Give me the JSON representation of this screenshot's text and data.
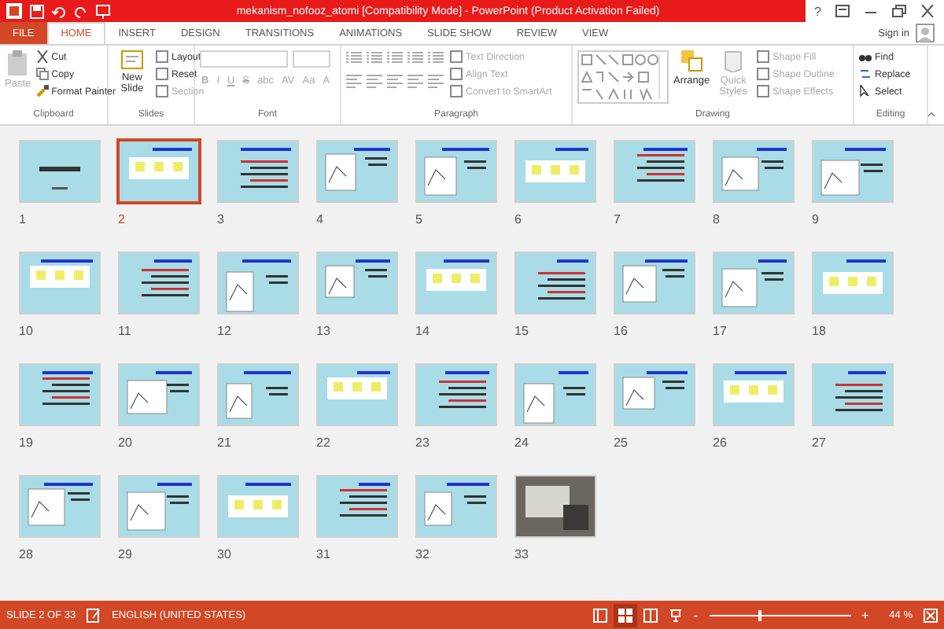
{
  "window": {
    "title": "mekanism_nofooz_atomi [Compatibility Mode] - PowerPoint (Product Activation Failed)",
    "help": "?"
  },
  "tabs": [
    {
      "label": "FILE",
      "kind": "file",
      "selected": false
    },
    {
      "label": "HOME",
      "kind": "tab",
      "selected": true
    },
    {
      "label": "INSERT",
      "kind": "tab",
      "selected": false
    },
    {
      "label": "DESIGN",
      "kind": "tab",
      "selected": false
    },
    {
      "label": "TRANSITIONS",
      "kind": "tab",
      "selected": false
    },
    {
      "label": "ANIMATIONS",
      "kind": "tab",
      "selected": false
    },
    {
      "label": "SLIDE SHOW",
      "kind": "tab",
      "selected": false
    },
    {
      "label": "REVIEW",
      "kind": "tab",
      "selected": false
    },
    {
      "label": "VIEW",
      "kind": "tab",
      "selected": false
    }
  ],
  "account": {
    "label": "Sign in"
  },
  "ribbon": {
    "clipboard": {
      "title": "Clipboard",
      "paste": {
        "label": "Paste",
        "disabled": true
      },
      "commands": [
        {
          "label": "Cut",
          "disabled": false
        },
        {
          "label": "Copy",
          "disabled": false
        },
        {
          "label": "Format Painter",
          "disabled": false
        }
      ]
    },
    "slides": {
      "title": "Slides",
      "new_slide": "New Slide",
      "commands": [
        {
          "label": "Layout",
          "disabled": false
        },
        {
          "label": "Reset",
          "disabled": false
        },
        {
          "label": "Section",
          "disabled": true
        }
      ]
    },
    "font": {
      "title": "Font",
      "disabled": true,
      "buttons": [
        "B",
        "I",
        "U",
        "S",
        "abc",
        "AV",
        "Aa",
        "A"
      ]
    },
    "paragraph": {
      "title": "Paragraph",
      "commands": [
        {
          "label": "Text Direction",
          "disabled": true
        },
        {
          "label": "Align Text",
          "disabled": true
        },
        {
          "label": "Convert to SmartArt",
          "disabled": true
        }
      ]
    },
    "drawing": {
      "title": "Drawing",
      "arrange": "Arrange",
      "quick_styles": "Quick Styles",
      "commands": [
        {
          "label": "Shape Fill",
          "disabled": true
        },
        {
          "label": "Shape Outline",
          "disabled": true
        },
        {
          "label": "Shape Effects",
          "disabled": true
        }
      ]
    },
    "editing": {
      "title": "Editing",
      "commands": [
        {
          "label": "Find",
          "disabled": false
        },
        {
          "label": "Replace",
          "disabled": false
        },
        {
          "label": "Select",
          "disabled": false
        }
      ]
    }
  },
  "slides": [
    {
      "number": "1",
      "kind": "title",
      "selected": false
    },
    {
      "number": "2",
      "kind": "content",
      "selected": true
    },
    {
      "number": "3",
      "kind": "content",
      "selected": false
    },
    {
      "number": "4",
      "kind": "content",
      "selected": false
    },
    {
      "number": "5",
      "kind": "content",
      "selected": false
    },
    {
      "number": "6",
      "kind": "content",
      "selected": false
    },
    {
      "number": "7",
      "kind": "content",
      "selected": false
    },
    {
      "number": "8",
      "kind": "content",
      "selected": false
    },
    {
      "number": "9",
      "kind": "content",
      "selected": false
    },
    {
      "number": "10",
      "kind": "content",
      "selected": false
    },
    {
      "number": "11",
      "kind": "content",
      "selected": false
    },
    {
      "number": "12",
      "kind": "content",
      "selected": false
    },
    {
      "number": "13",
      "kind": "content",
      "selected": false
    },
    {
      "number": "14",
      "kind": "content",
      "selected": false
    },
    {
      "number": "15",
      "kind": "content",
      "selected": false
    },
    {
      "number": "16",
      "kind": "content",
      "selected": false
    },
    {
      "number": "17",
      "kind": "content",
      "selected": false
    },
    {
      "number": "18",
      "kind": "content",
      "selected": false
    },
    {
      "number": "19",
      "kind": "content",
      "selected": false
    },
    {
      "number": "20",
      "kind": "content",
      "selected": false
    },
    {
      "number": "21",
      "kind": "content",
      "selected": false
    },
    {
      "number": "22",
      "kind": "content",
      "selected": false
    },
    {
      "number": "23",
      "kind": "content",
      "selected": false
    },
    {
      "number": "24",
      "kind": "content",
      "selected": false
    },
    {
      "number": "25",
      "kind": "content",
      "selected": false
    },
    {
      "number": "26",
      "kind": "content",
      "selected": false
    },
    {
      "number": "27",
      "kind": "content",
      "selected": false
    },
    {
      "number": "28",
      "kind": "content",
      "selected": false
    },
    {
      "number": "29",
      "kind": "content",
      "selected": false
    },
    {
      "number": "30",
      "kind": "content",
      "selected": false
    },
    {
      "number": "31",
      "kind": "content",
      "selected": false
    },
    {
      "number": "32",
      "kind": "content",
      "selected": false
    },
    {
      "number": "33",
      "kind": "photo",
      "selected": false
    }
  ],
  "status_bar": {
    "slide": "SLIDE 2 OF 33",
    "language": "ENGLISH (UNITED STATES)",
    "zoom": "44 %",
    "zoom_out": "-",
    "zoom_in": "+",
    "zoom_slider": {
      "level": 0.35
    }
  }
}
